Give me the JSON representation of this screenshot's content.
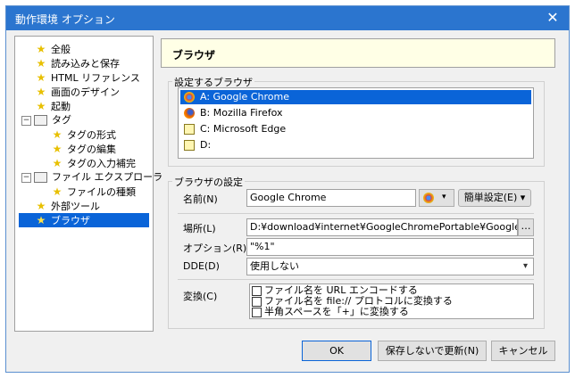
{
  "window": {
    "title": "動作環境 オプション",
    "close_icon": "✕"
  },
  "tree": {
    "items": [
      {
        "label": "全般",
        "icon": "star-icon"
      },
      {
        "label": "読み込みと保存",
        "icon": "star-icon"
      },
      {
        "label": "HTML リファレンス",
        "icon": "star-icon"
      },
      {
        "label": "画面のデザイン",
        "icon": "star-icon"
      },
      {
        "label": "起動",
        "icon": "star-icon"
      },
      {
        "label": "タグ",
        "icon": "folder-icon"
      },
      {
        "label": "タグの形式",
        "icon": "star-icon"
      },
      {
        "label": "タグの編集",
        "icon": "star-icon"
      },
      {
        "label": "タグの入力補完",
        "icon": "star-icon"
      },
      {
        "label": "ファイル エクスプローラ",
        "icon": "folder-icon"
      },
      {
        "label": "ファイルの種類",
        "icon": "star-icon"
      },
      {
        "label": "外部ツール",
        "icon": "star-icon"
      },
      {
        "label": "ブラウザ",
        "icon": "star-icon",
        "selected": true
      }
    ]
  },
  "panel": {
    "title": "ブラウザ"
  },
  "browser_select": {
    "group_label": "設定するブラウザ",
    "items": [
      {
        "label": "A: Google Chrome",
        "icon": "chrome-icon",
        "selected": true
      },
      {
        "label": "B: Mozilla Firefox",
        "icon": "firefox-icon"
      },
      {
        "label": "C: Microsoft Edge",
        "icon": "blank-browser-icon"
      },
      {
        "label": "D:",
        "icon": "blank-browser-icon"
      }
    ]
  },
  "browser_settings": {
    "group_label": "ブラウザの設定",
    "name_label": "名前(N)",
    "name_value": "Google Chrome",
    "simple_settings_label": "簡単設定(E) ▾",
    "location_label": "場所(L)",
    "location_value": "D:¥download¥internet¥GoogleChromePortable¥GoogleChrom",
    "browse_label": "…",
    "option_label": "オプション(R)",
    "option_value": "\"%1\"",
    "dde_label": "DDE(D)",
    "dde_value": "使用しない",
    "convert_label": "変換(C)",
    "convert_options": [
      "ファイル名を URL エンコードする",
      "ファイル名を file:// プロトコルに変換する",
      "半角スペースを「+」に変換する"
    ]
  },
  "buttons": {
    "ok": "OK",
    "update_without_save": "保存しないで更新(N)",
    "cancel": "キャンセル"
  },
  "colors": {
    "accent": "#0a64d8",
    "titlebar": "#2b75cf",
    "header_bg": "#ffffe6"
  }
}
